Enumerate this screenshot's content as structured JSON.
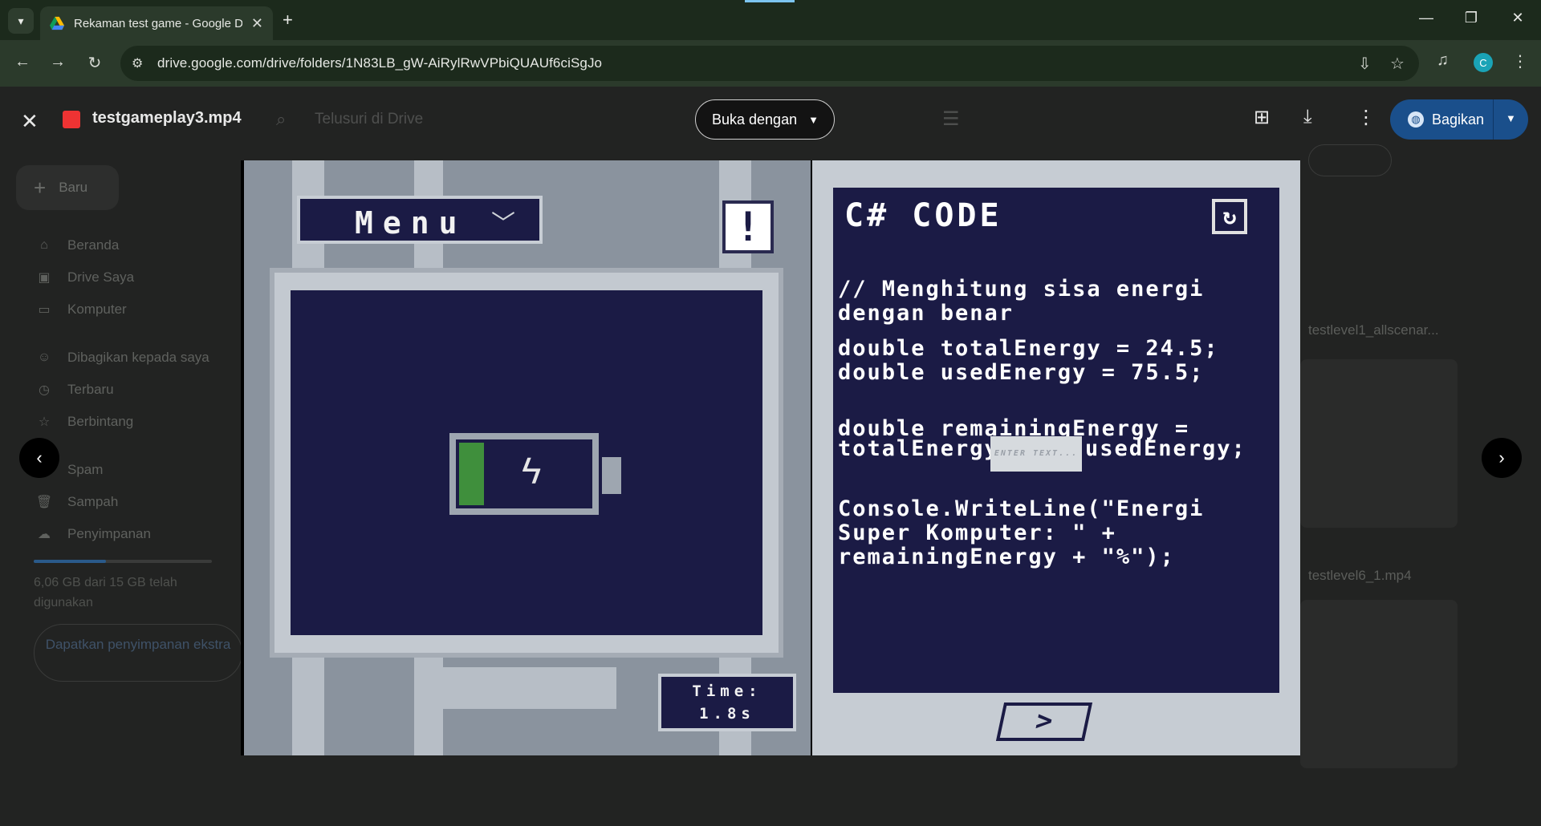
{
  "browser": {
    "tab_title": "Rekaman test game - Google D",
    "url": "drive.google.com/drive/folders/1N83LB_gW-AiRylRwVPbiQUAUf6ciSgJo",
    "profile_initial": "C"
  },
  "drive": {
    "new_label": "Baru",
    "nav": [
      {
        "label": "Beranda",
        "icon": "home-icon"
      },
      {
        "label": "Drive Saya",
        "icon": "drive-icon"
      },
      {
        "label": "Komputer",
        "icon": "computer-icon"
      },
      {
        "label": "Dibagikan kepada saya",
        "icon": "shared-icon"
      },
      {
        "label": "Terbaru",
        "icon": "clock-icon"
      },
      {
        "label": "Berbintang",
        "icon": "star-icon"
      },
      {
        "label": "Spam",
        "icon": "spam-icon"
      },
      {
        "label": "Sampah",
        "icon": "trash-icon"
      },
      {
        "label": "Penyimpanan",
        "icon": "cloud-icon"
      }
    ],
    "storage_text": "6,06 GB dari 15 GB telah digunakan",
    "storage_button": "Dapatkan penyimpanan ekstra",
    "storage_used_fraction": 0.404,
    "files": [
      "testlevel1_allscenar...",
      "testlevel6_1.mp4"
    ]
  },
  "viewer": {
    "file_name": "testgameplay3.mp4",
    "search_placeholder": "Telusuri di Drive",
    "open_with_label": "Buka dengan",
    "share_label": "Bagikan"
  },
  "game": {
    "menu_label": "Menu",
    "alert_symbol": "!",
    "time_label": "Time:",
    "time_value": "1.8s",
    "battery_level": 0.18,
    "code_title": "C# CODE",
    "code_comment": "// Menghitung sisa energi\ndengan benar",
    "code_vars": "double totalEnergy = 24.5;\ndouble usedEnergy = 75.5;",
    "code_expr_1": "double remainingEnergy =",
    "code_expr_2_left": "totalEnergy",
    "code_expr_2_right": "usedEnergy;",
    "input_placeholder": "ENTER TEXT...",
    "code_print": "Console.WriteLine(\"Energi\nSuper Komputer: \" +\nremainingEnergy + \"%\");"
  },
  "colors": {
    "accent_blue": "#1a4f8b",
    "game_navy": "#1b1b45",
    "battery_green": "#3f8f3c"
  }
}
